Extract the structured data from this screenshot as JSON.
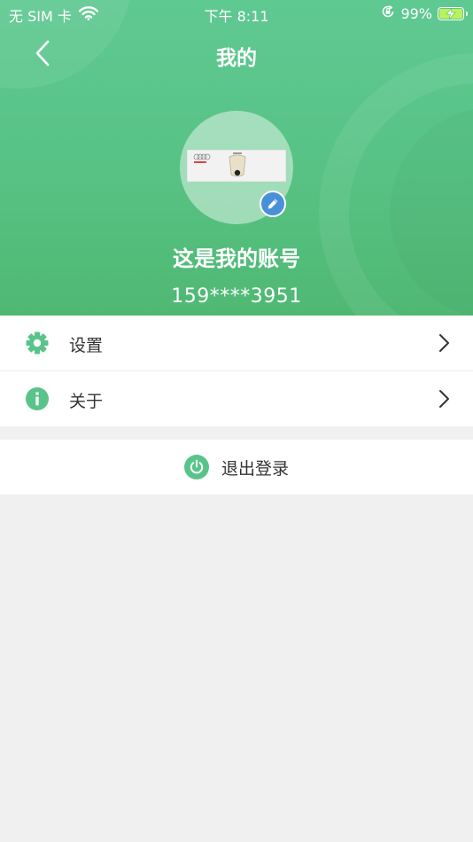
{
  "status_bar": {
    "carrier": "无 SIM 卡",
    "time": "下午 8:11",
    "battery": "99%",
    "battery_level": 0.99,
    "icons": [
      "wifi-icon",
      "orientation-lock-icon",
      "battery-charging-icon"
    ]
  },
  "nav": {
    "title": "我的",
    "back_icon": "chevron-left-icon"
  },
  "profile": {
    "name": "这是我的账号",
    "phone": "159****3951",
    "edit_icon": "pencil-icon"
  },
  "menu": {
    "items": [
      {
        "label": "设置",
        "icon": "gear-icon"
      },
      {
        "label": "关于",
        "icon": "info-icon"
      }
    ]
  },
  "logout": {
    "label": "退出登录",
    "icon": "power-icon"
  },
  "colors": {
    "header_green": "#57c284",
    "icon_green": "#59c48a",
    "edit_badge_blue": "#4a90d9",
    "background": "#f0f0f0"
  }
}
